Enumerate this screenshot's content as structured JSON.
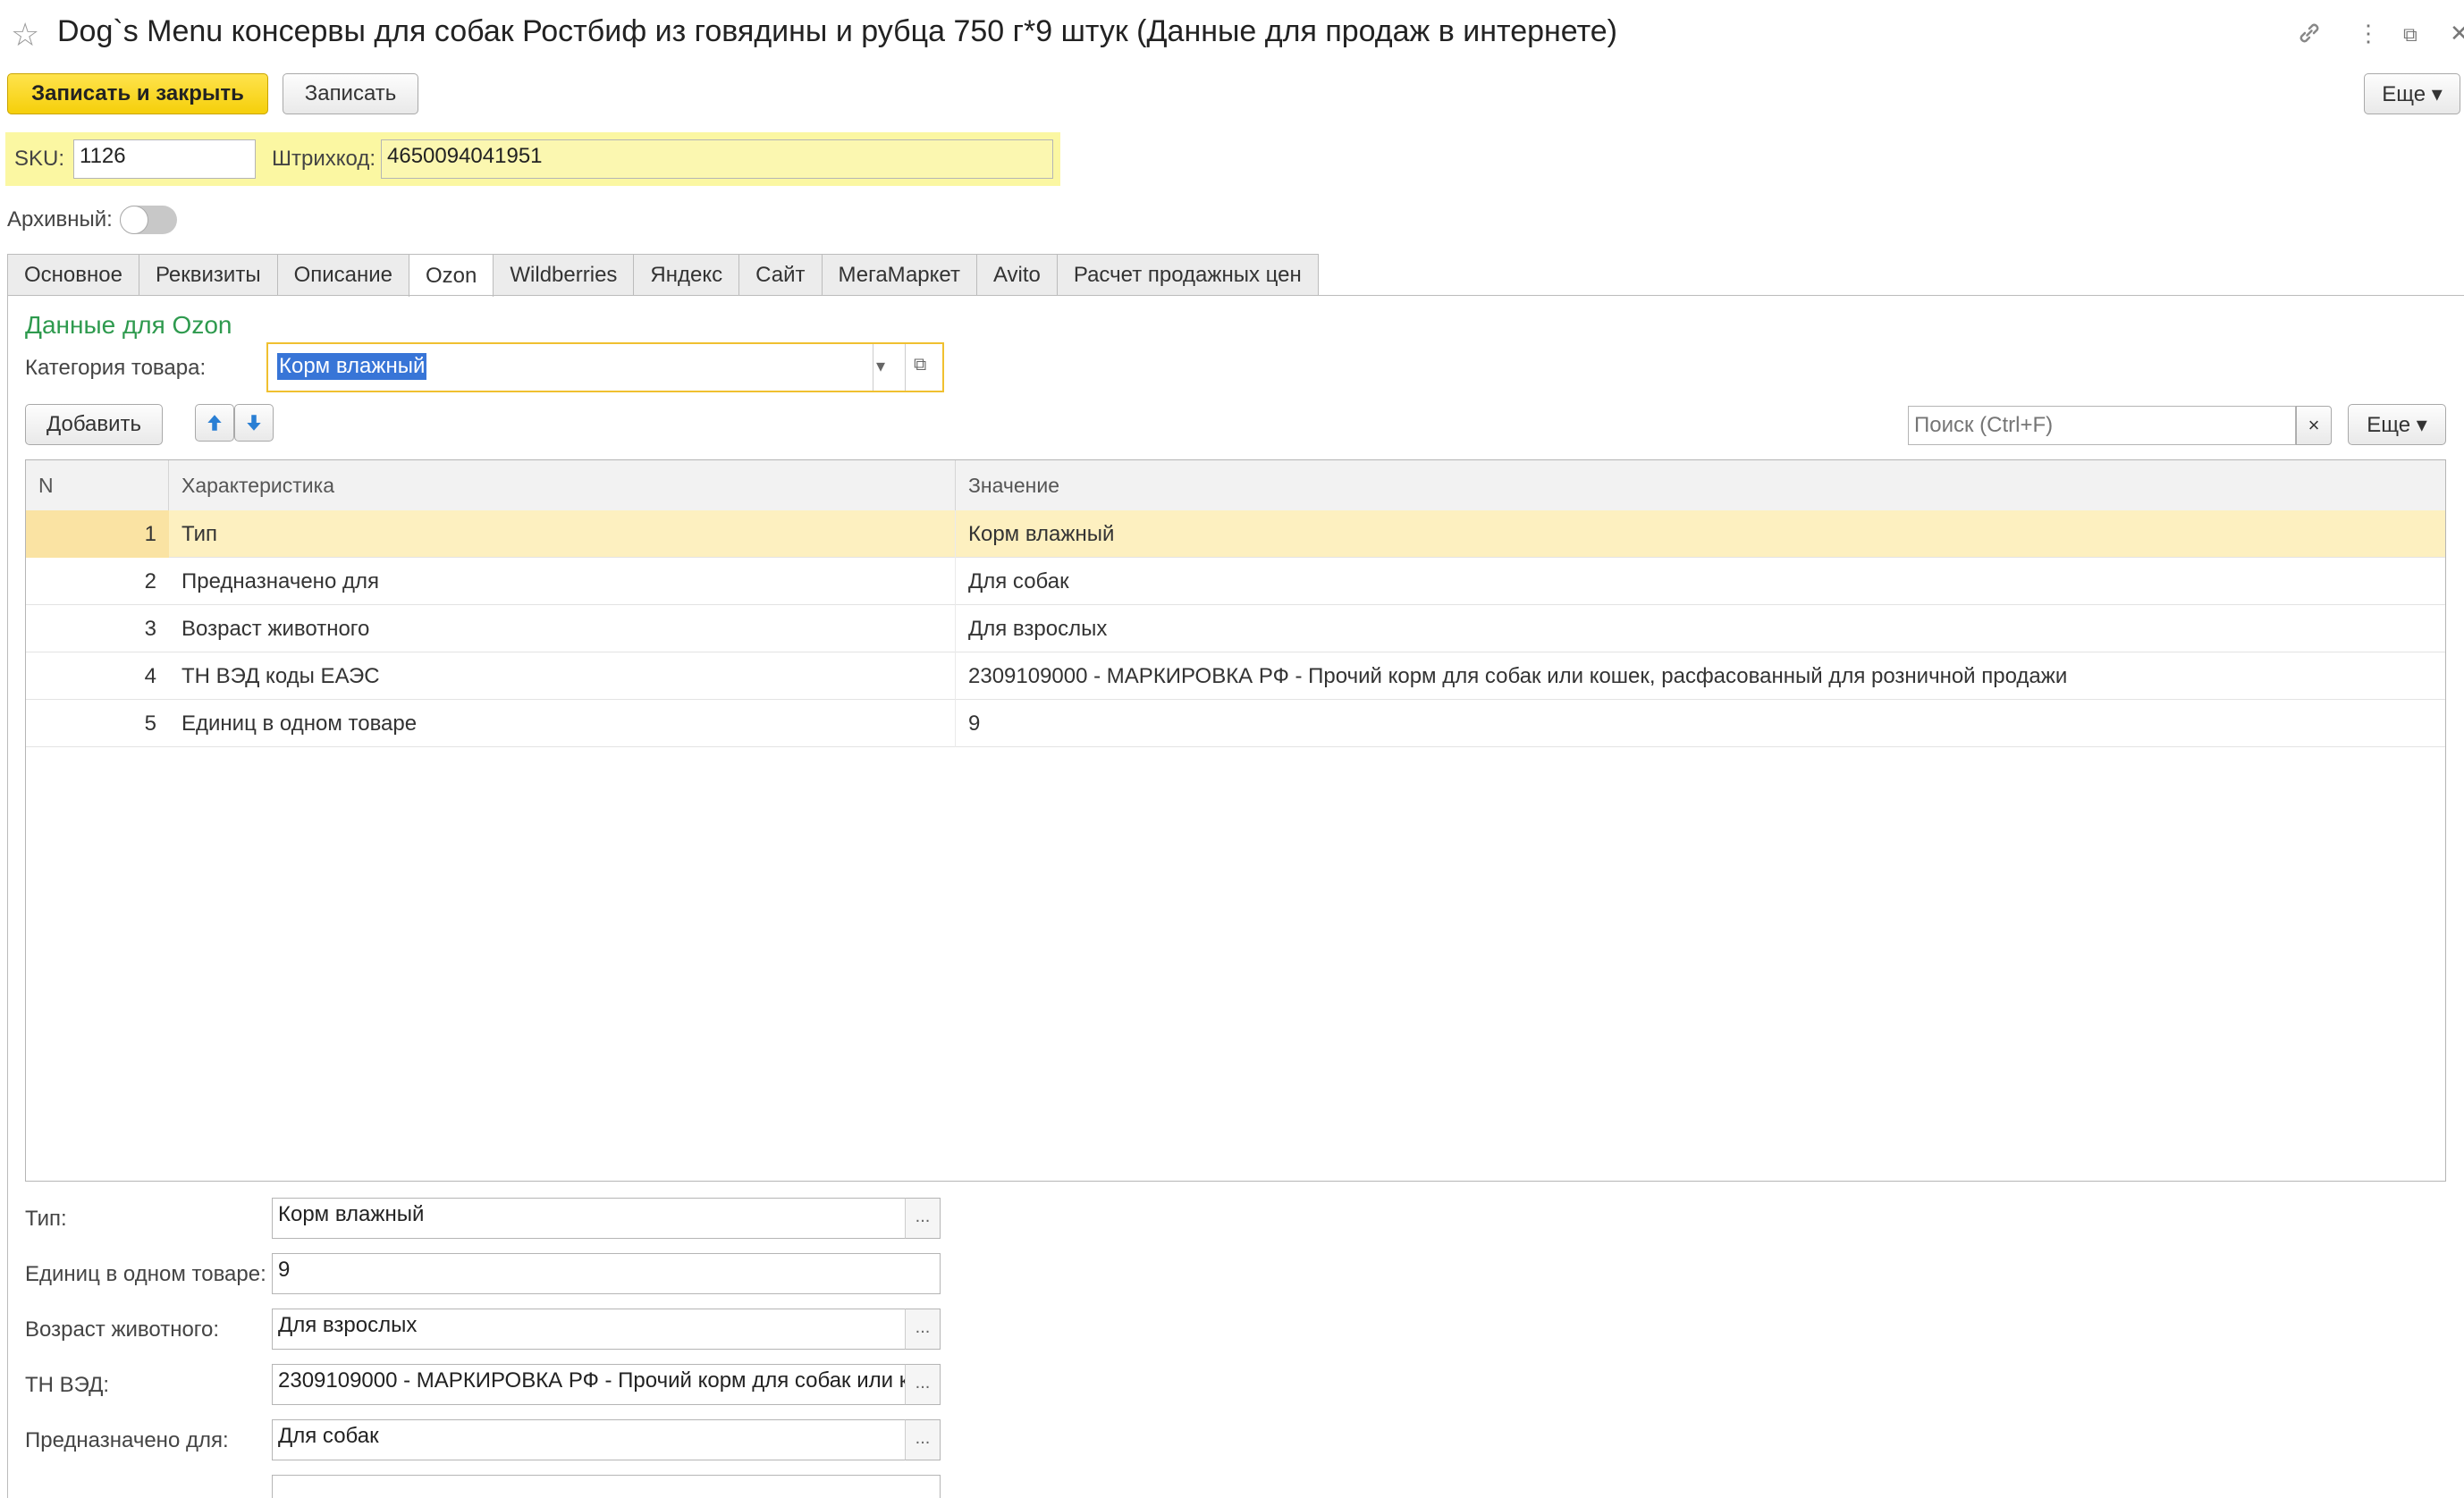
{
  "header": {
    "title": "Dog`s Menu консервы для собак Ростбиф из говядины и рубца 750 г*9 штук (Данные для продаж в интернете)",
    "star_icon": "star-icon",
    "link_icon": "link-icon",
    "more_icon": "kebab-icon",
    "restore_icon": "window-restore-icon",
    "close_icon": "close-icon",
    "star_glyph": "☆",
    "more_glyph": "⋮",
    "restore_glyph": "⧉",
    "close_glyph": "✕",
    "link_glyph": "🔗"
  },
  "toolbar": {
    "save_close_label": "Записать и закрыть",
    "save_label": "Записать",
    "more_label": "Еще ▾"
  },
  "ids": {
    "sku_label": "SKU:",
    "sku_value": "1126",
    "barcode_label": "Штрихкод:",
    "barcode_value": "4650094041951"
  },
  "archive": {
    "label": "Архивный:",
    "value": false
  },
  "tabs": [
    {
      "label": "Основное"
    },
    {
      "label": "Реквизиты"
    },
    {
      "label": "Описание"
    },
    {
      "label": "Ozon",
      "active": true
    },
    {
      "label": "Wildberries"
    },
    {
      "label": "Яндекс"
    },
    {
      "label": "Сайт"
    },
    {
      "label": "МегаМаркет"
    },
    {
      "label": "Avito"
    },
    {
      "label": "Расчет продажных цен"
    }
  ],
  "ozon": {
    "section_title": "Данные для Ozon",
    "category_label": "Категория товара:",
    "category_value": "Корм влажный",
    "add_label": "Добавить",
    "search_placeholder": "Поиск (Ctrl+F)",
    "search_clear": "×",
    "more_label": "Еще ▾",
    "up_glyph": "🡅",
    "down_glyph": "🡇",
    "dropdown_glyph": "▾",
    "open_glyph": "⧉"
  },
  "table": {
    "columns": [
      "N",
      "Характеристика",
      "Значение"
    ],
    "rows": [
      {
        "n": "1",
        "characteristic": "Тип",
        "value": "Корм влажный"
      },
      {
        "n": "2",
        "characteristic": "Предназначено для",
        "value": "Для собак"
      },
      {
        "n": "3",
        "characteristic": "Возраст животного",
        "value": "Для взрослых"
      },
      {
        "n": "4",
        "characteristic": "ТН ВЭД коды ЕАЭС",
        "value": "2309109000 - МАРКИРОВКА РФ - Прочий корм для собак или кошек, расфасованный для розничной продажи"
      },
      {
        "n": "5",
        "characteristic": "Единиц в одном товаре",
        "value": "9"
      }
    ]
  },
  "fields": [
    {
      "label": "Тип:",
      "value": "Корм влажный",
      "has_button": true
    },
    {
      "label": "Единиц в одном товаре:",
      "value": "9",
      "has_button": false
    },
    {
      "label": "Возраст животного:",
      "value": "Для взрослых",
      "has_button": true
    },
    {
      "label": "ТН ВЭД:",
      "value": "2309109000 - МАРКИРОВКА РФ - Прочий корм для собак или к",
      "has_button": true
    },
    {
      "label": "Предназначено для:",
      "value": "Для собак",
      "has_button": true
    }
  ],
  "dots_glyph": "..."
}
